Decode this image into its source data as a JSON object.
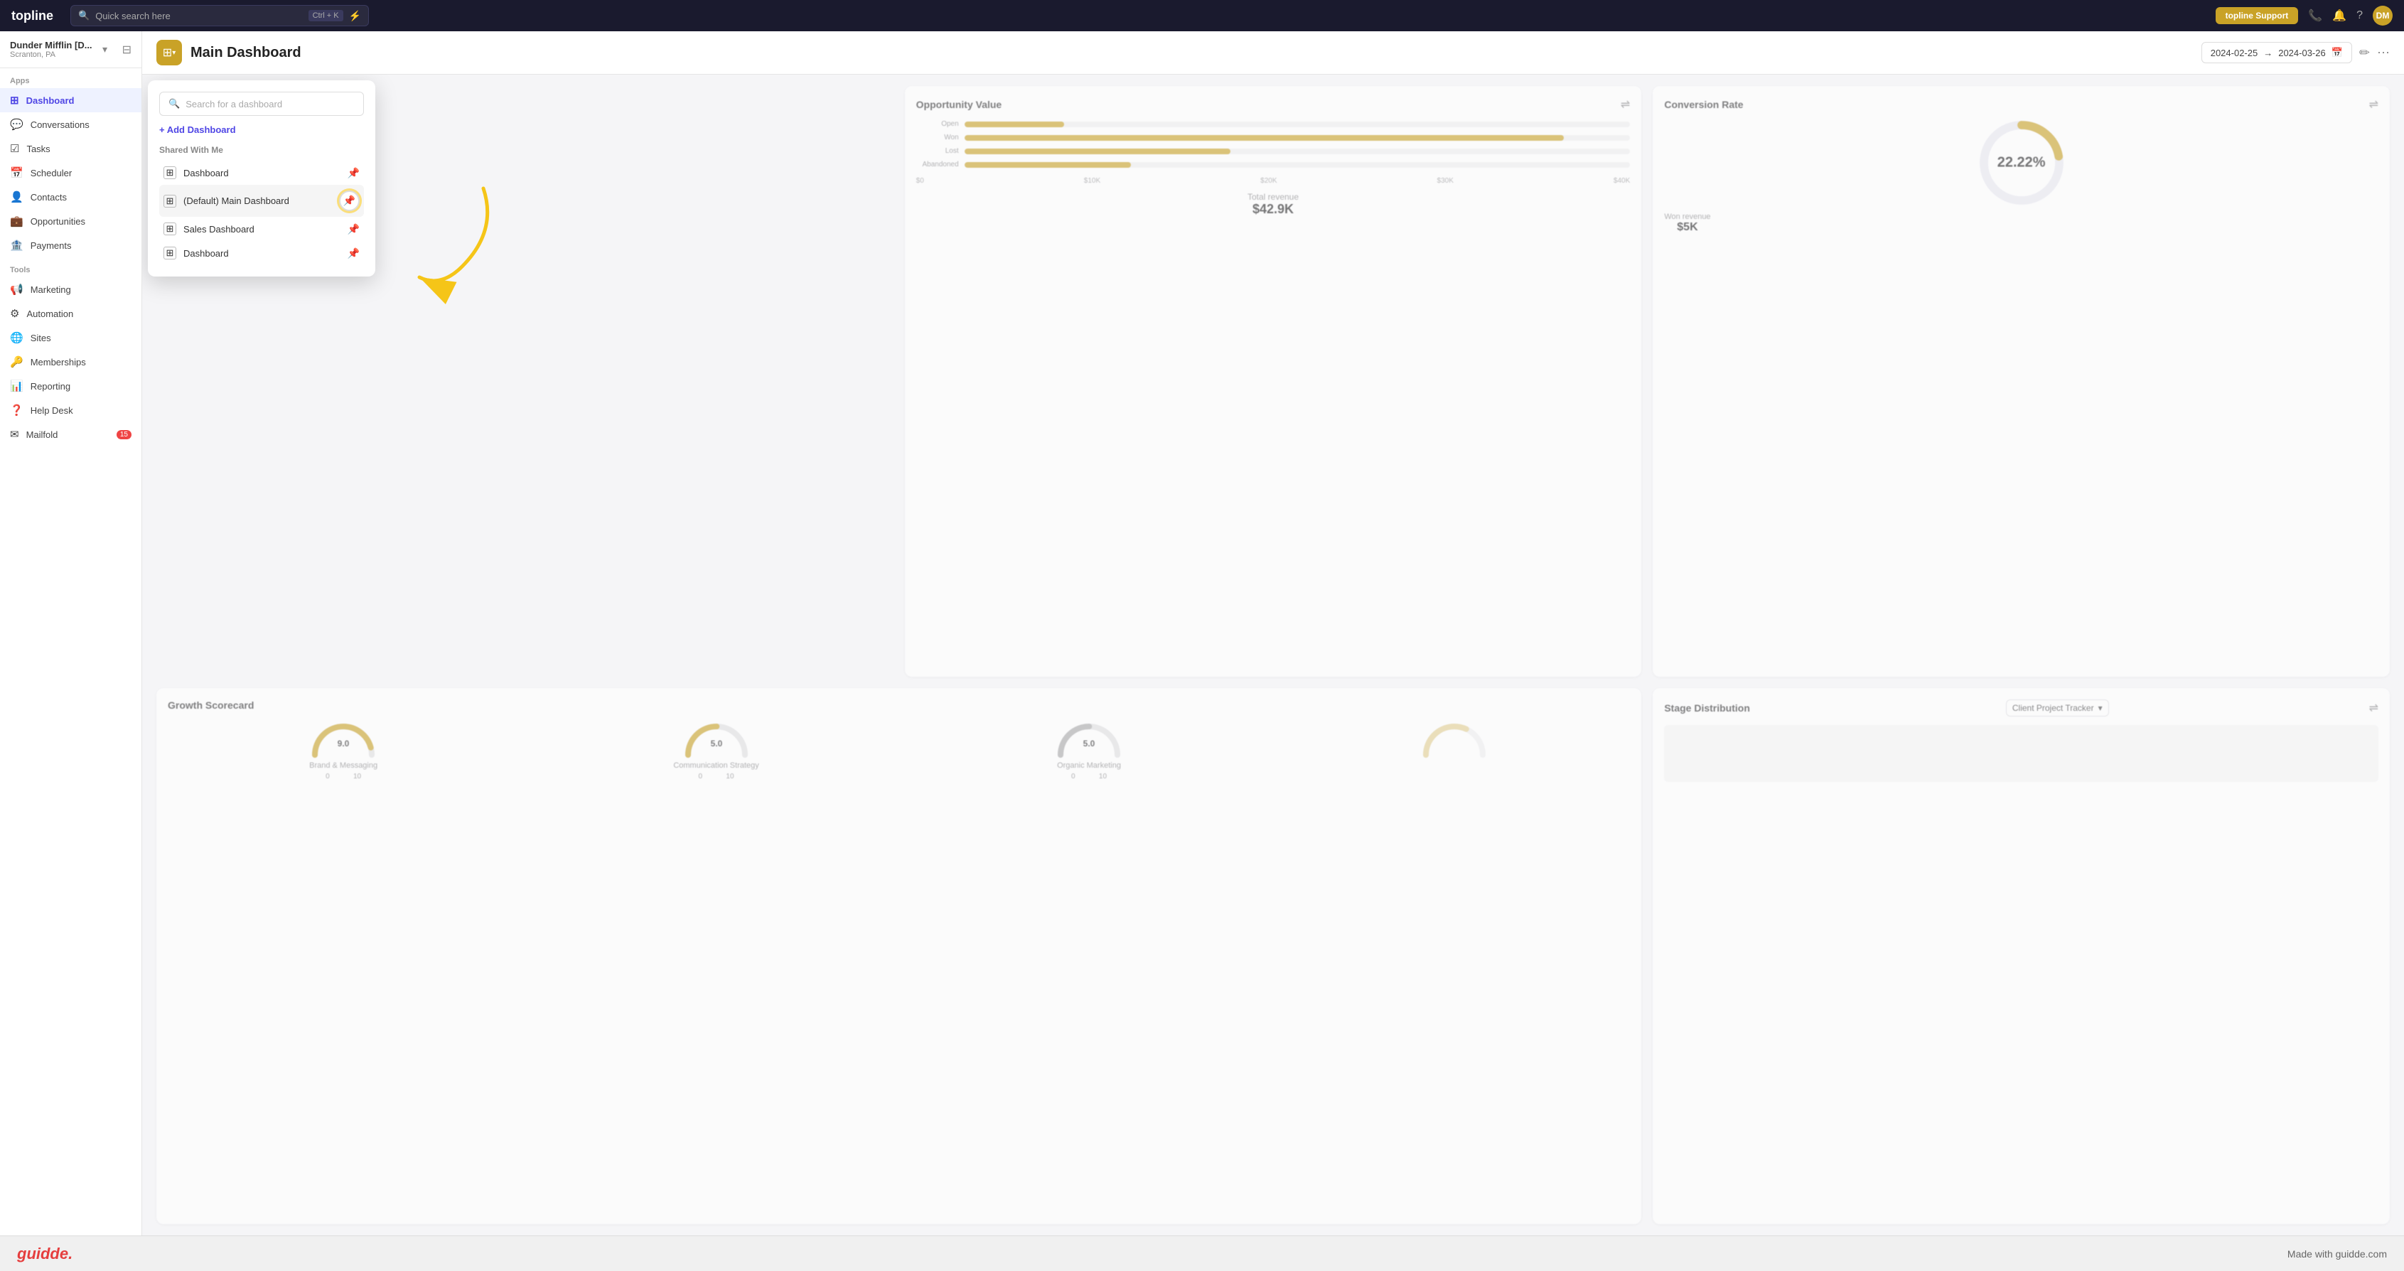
{
  "topnav": {
    "logo": "topline",
    "search_placeholder": "Quick search here",
    "search_shortcut": "Ctrl + K",
    "support_label": "topline Support",
    "lightning_icon": "⚡",
    "phone_icon": "📞",
    "bell_icon": "🔔",
    "help_icon": "?",
    "avatar_initials": "DM"
  },
  "sidebar": {
    "workspace_name": "Dunder Mifflin [D...",
    "workspace_sub": "Scranton, PA",
    "apps_label": "Apps",
    "tools_label": "Tools",
    "items_apps": [
      {
        "id": "dashboard",
        "label": "Dashboard",
        "icon": "⊞",
        "active": true
      },
      {
        "id": "conversations",
        "label": "Conversations",
        "icon": "💬",
        "active": false
      },
      {
        "id": "tasks",
        "label": "Tasks",
        "icon": "☑",
        "active": false
      },
      {
        "id": "scheduler",
        "label": "Scheduler",
        "icon": "📅",
        "active": false
      },
      {
        "id": "contacts",
        "label": "Contacts",
        "icon": "👤",
        "active": false
      },
      {
        "id": "opportunities",
        "label": "Opportunities",
        "icon": "💼",
        "active": false
      },
      {
        "id": "payments",
        "label": "Payments",
        "icon": "🏦",
        "active": false
      }
    ],
    "items_tools": [
      {
        "id": "marketing",
        "label": "Marketing",
        "icon": "📢",
        "active": false
      },
      {
        "id": "automation",
        "label": "Automation",
        "icon": "⚙",
        "active": false
      },
      {
        "id": "sites",
        "label": "Sites",
        "icon": "🌐",
        "active": false
      },
      {
        "id": "memberships",
        "label": "Memberships",
        "icon": "🔑",
        "active": false
      },
      {
        "id": "reporting",
        "label": "Reporting",
        "icon": "📊",
        "active": false
      },
      {
        "id": "helpdesk",
        "label": "Help Desk",
        "icon": "❓",
        "active": false
      },
      {
        "id": "mailfold",
        "label": "Mailfold",
        "icon": "✉",
        "active": false,
        "badge": "15"
      }
    ]
  },
  "header": {
    "title": "Main Dashboard",
    "date_start": "2024-02-25",
    "date_arrow": "→",
    "date_end": "2024-03-26",
    "edit_icon": "✏",
    "more_icon": "⋯"
  },
  "dropdown": {
    "search_placeholder": "Search for a dashboard",
    "add_label": "+ Add Dashboard",
    "section_label": "Shared With Me",
    "items": [
      {
        "label": "Dashboard",
        "pinned": false
      },
      {
        "label": "(Default) Main Dashboard",
        "pinned": true,
        "highlighted": true
      },
      {
        "label": "Sales Dashboard",
        "pinned": false
      },
      {
        "label": "Dashboard",
        "pinned": false
      }
    ]
  },
  "cards": {
    "opportunity": {
      "title": "Opportunity Value",
      "bars": [
        {
          "label": "Open",
          "pct": 15
        },
        {
          "label": "Won",
          "pct": 90
        },
        {
          "label": "Lost",
          "pct": 40
        },
        {
          "label": "Abandoned",
          "pct": 25
        }
      ],
      "axis_labels": [
        "$0",
        "$10K",
        "$20K",
        "$30K",
        "$40K"
      ],
      "total_label": "Total revenue",
      "total_value": "$42.9K"
    },
    "conversion": {
      "title": "Conversion Rate",
      "percentage": "22.22%",
      "donut_value": 22.22,
      "won_label": "Won revenue",
      "won_value": "$5K"
    },
    "growth": {
      "title": "Growth Scorecard",
      "gauges": [
        {
          "label": "Brand & Messaging",
          "value": "9.0",
          "pct": 90
        },
        {
          "label": "Communication Strategy",
          "value": "5.0",
          "pct": 50
        },
        {
          "label": "Organic Marketing",
          "value": "5.0",
          "pct": 50
        }
      ]
    },
    "stage": {
      "title": "Stage Distribution",
      "tracker_label": "Client Project Tracker",
      "chevron": "▾"
    }
  },
  "guidde": {
    "logo": "guidde.",
    "made_with": "Made with guidde.com"
  }
}
